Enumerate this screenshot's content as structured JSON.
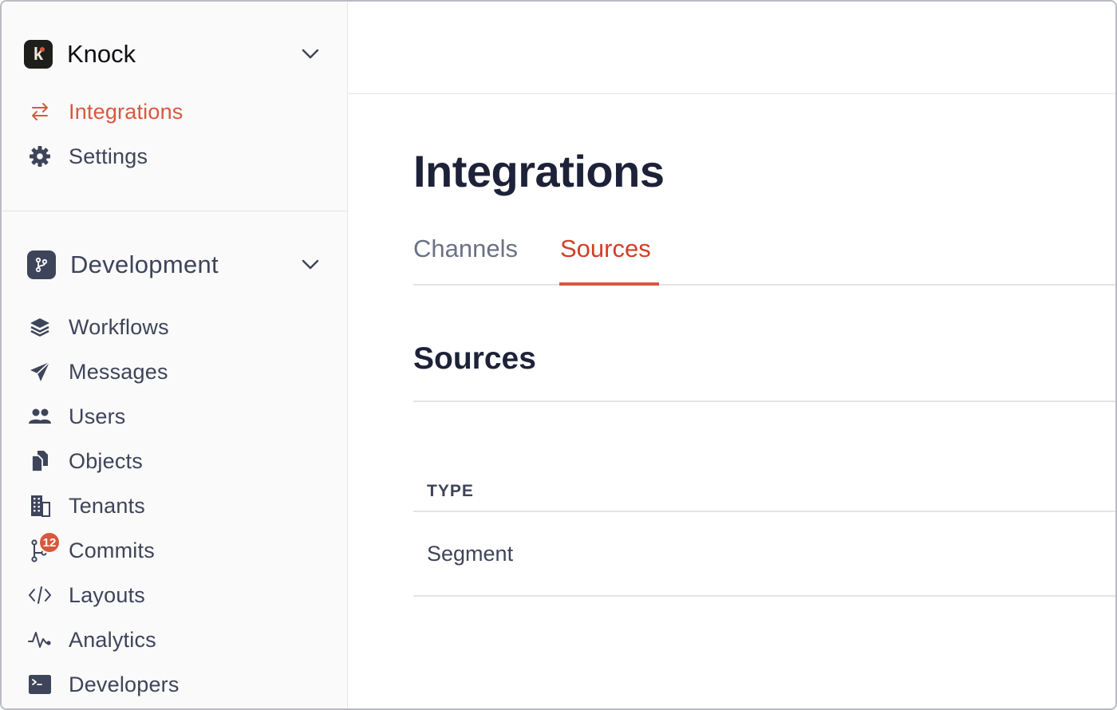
{
  "sidebar": {
    "account": {
      "logo_letter": "k",
      "name": "Knock"
    },
    "top_items": [
      {
        "label": "Integrations",
        "icon": "arrows-exchange-icon",
        "active": true
      },
      {
        "label": "Settings",
        "icon": "gear-icon",
        "active": false
      }
    ],
    "environment": {
      "name": "Development",
      "icon": "git-branch-icon"
    },
    "items": [
      {
        "label": "Workflows",
        "icon": "layers-icon"
      },
      {
        "label": "Messages",
        "icon": "paper-plane-icon"
      },
      {
        "label": "Users",
        "icon": "users-icon"
      },
      {
        "label": "Objects",
        "icon": "documents-icon"
      },
      {
        "label": "Tenants",
        "icon": "building-icon"
      },
      {
        "label": "Commits",
        "icon": "git-commit-icon",
        "badge": "12"
      },
      {
        "label": "Layouts",
        "icon": "code-icon"
      },
      {
        "label": "Analytics",
        "icon": "pulse-icon"
      },
      {
        "label": "Developers",
        "icon": "terminal-icon"
      }
    ]
  },
  "main": {
    "title": "Integrations",
    "tabs": [
      {
        "label": "Channels",
        "active": false
      },
      {
        "label": "Sources",
        "active": true
      }
    ],
    "section_title": "Sources",
    "table": {
      "columns": [
        "TYPE"
      ],
      "rows": [
        [
          "Segment"
        ]
      ]
    }
  },
  "colors": {
    "accent": "#d8573f",
    "text_dark": "#1d2238",
    "text_muted": "#3e4459",
    "border": "#e3e4e7"
  }
}
